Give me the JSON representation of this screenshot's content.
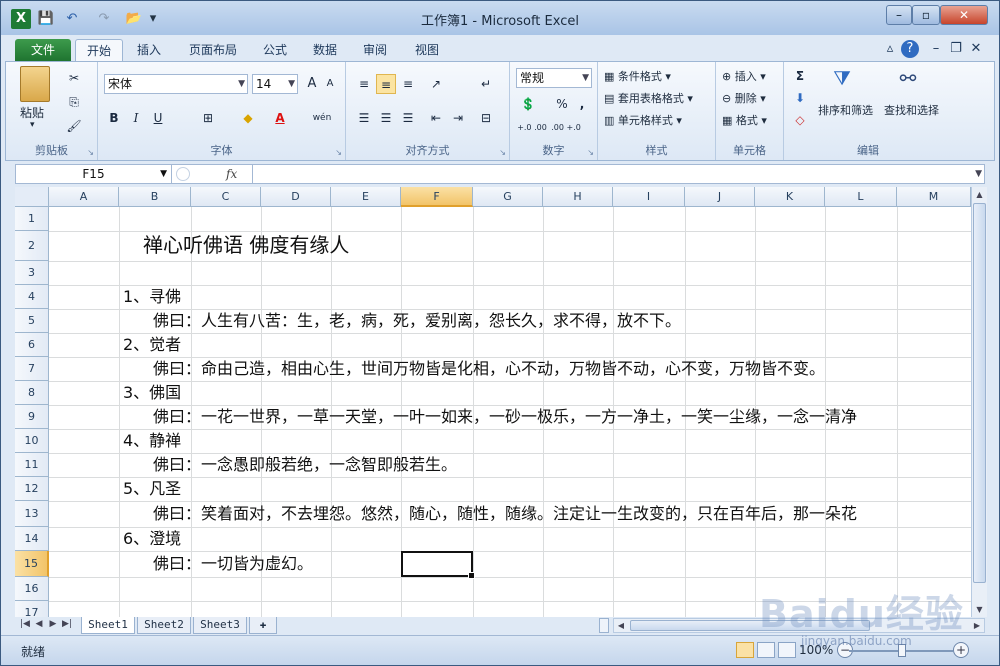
{
  "window": {
    "title": "工作簿1 - Microsoft Excel",
    "app_icon": "X"
  },
  "qat": {
    "save_icon": "💾",
    "undo_icon": "↶",
    "redo_icon": "↷",
    "open_icon": "📂",
    "customize_icon": "▾"
  },
  "tabs": [
    "文件",
    "开始",
    "插入",
    "页面布局",
    "公式",
    "数据",
    "审阅",
    "视图"
  ],
  "ribbon": {
    "clipboard": {
      "label": "剪贴板",
      "paste": "粘贴"
    },
    "font": {
      "label": "字体",
      "name": "宋体",
      "size": "14",
      "bold": "B",
      "italic": "I",
      "underline": "U",
      "grow": "A",
      "shrink": "A",
      "font_color": "A",
      "wen": "wén"
    },
    "alignment": {
      "label": "对齐方式"
    },
    "number": {
      "label": "数字",
      "format": "常规",
      "percent": "%",
      "comma": ",",
      "inc_dec": "+.0 .00",
      "dec_dec": ".00 +.0"
    },
    "styles": {
      "label": "样式",
      "conditional": "条件格式",
      "table": "套用表格格式",
      "cell_styles": "单元格样式"
    },
    "cells": {
      "label": "单元格",
      "insert": "插入",
      "delete": "删除",
      "format": "格式"
    },
    "editing": {
      "label": "编辑",
      "sort": "排序和筛选",
      "find": "查找和选择",
      "sigma": "Σ"
    }
  },
  "formula_bar": {
    "name_box": "F15",
    "fx": "fx",
    "value": ""
  },
  "columns": [
    "A",
    "B",
    "C",
    "D",
    "E",
    "F",
    "G",
    "H",
    "I",
    "J",
    "K",
    "L",
    "M"
  ],
  "rows": [
    "1",
    "2",
    "3",
    "4",
    "5",
    "6",
    "7",
    "8",
    "9",
    "10",
    "11",
    "12",
    "13",
    "14",
    "15",
    "16",
    "17"
  ],
  "cells": {
    "r2": "禅心听佛语 佛度有缘人",
    "r4": "1、寻佛",
    "r5": "佛曰：人生有八苦：生，老，病，死，爱别离，怨长久，求不得，放不下。",
    "r6": "2、觉者",
    "r7": "佛曰：命由己造，相由心生，世间万物皆是化相，心不动，万物皆不动，心不变，万物皆不变。",
    "r8": "3、佛国",
    "r9": "佛曰：一花一世界，一草一天堂，一叶一如来，一砂一极乐，一方一净土，一笑一尘缘，一念一清净",
    "r10": "4、静禅",
    "r11": "佛曰：一念愚即般若绝，一念智即般若生。",
    "r12": "5、凡圣",
    "r13": "佛曰：笑着面对，不去埋怨。悠然，随心，随性，随缘。注定让一生改变的，只在百年后，那一朵花",
    "r14": "6、澄境",
    "r15": "佛曰：一切皆为虚幻。"
  },
  "sheets": [
    "Sheet1",
    "Sheet2",
    "Sheet3"
  ],
  "status": {
    "ready": "就绪",
    "zoom": "100%"
  },
  "watermark": {
    "logo": "Baidu经验",
    "url": "jingyan.baidu.com"
  },
  "colors": {
    "file_tab": "#2a8a3c",
    "active_header": "#f2c469",
    "ribbon_bg": "#dde8f5"
  }
}
